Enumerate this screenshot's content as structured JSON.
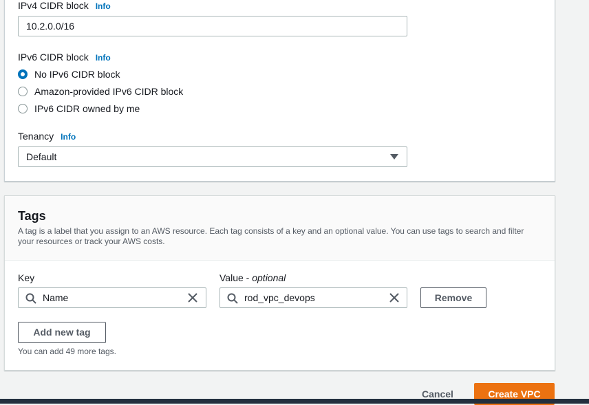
{
  "vpc_settings": {
    "ipv4": {
      "label": "IPv4 CIDR block",
      "info": "Info",
      "value": "10.2.0.0/16"
    },
    "ipv6": {
      "label": "IPv6 CIDR block",
      "info": "Info",
      "options": [
        {
          "label": "No IPv6 CIDR block",
          "checked": true
        },
        {
          "label": "Amazon-provided IPv6 CIDR block",
          "checked": false
        },
        {
          "label": "IPv6 CIDR owned by me",
          "checked": false
        }
      ]
    },
    "tenancy": {
      "label": "Tenancy",
      "info": "Info",
      "value": "Default"
    }
  },
  "tags": {
    "title": "Tags",
    "description": "A tag is a label that you assign to an AWS resource. Each tag consists of a key and an optional value. You can use tags to search and filter your resources or track your AWS costs.",
    "key_label": "Key",
    "value_label": "Value",
    "value_optional": "optional",
    "value_separator": " - ",
    "rows": [
      {
        "key": "Name",
        "value": "rod_vpc_devops",
        "remove_label": "Remove"
      }
    ],
    "add_label": "Add new tag",
    "remaining_note": "You can add 49 more tags."
  },
  "footer": {
    "cancel_label": "Cancel",
    "create_label": "Create VPC"
  },
  "colors": {
    "link": "#0073bb",
    "primary": "#ec7211",
    "radio_selected": "#0073bb"
  }
}
